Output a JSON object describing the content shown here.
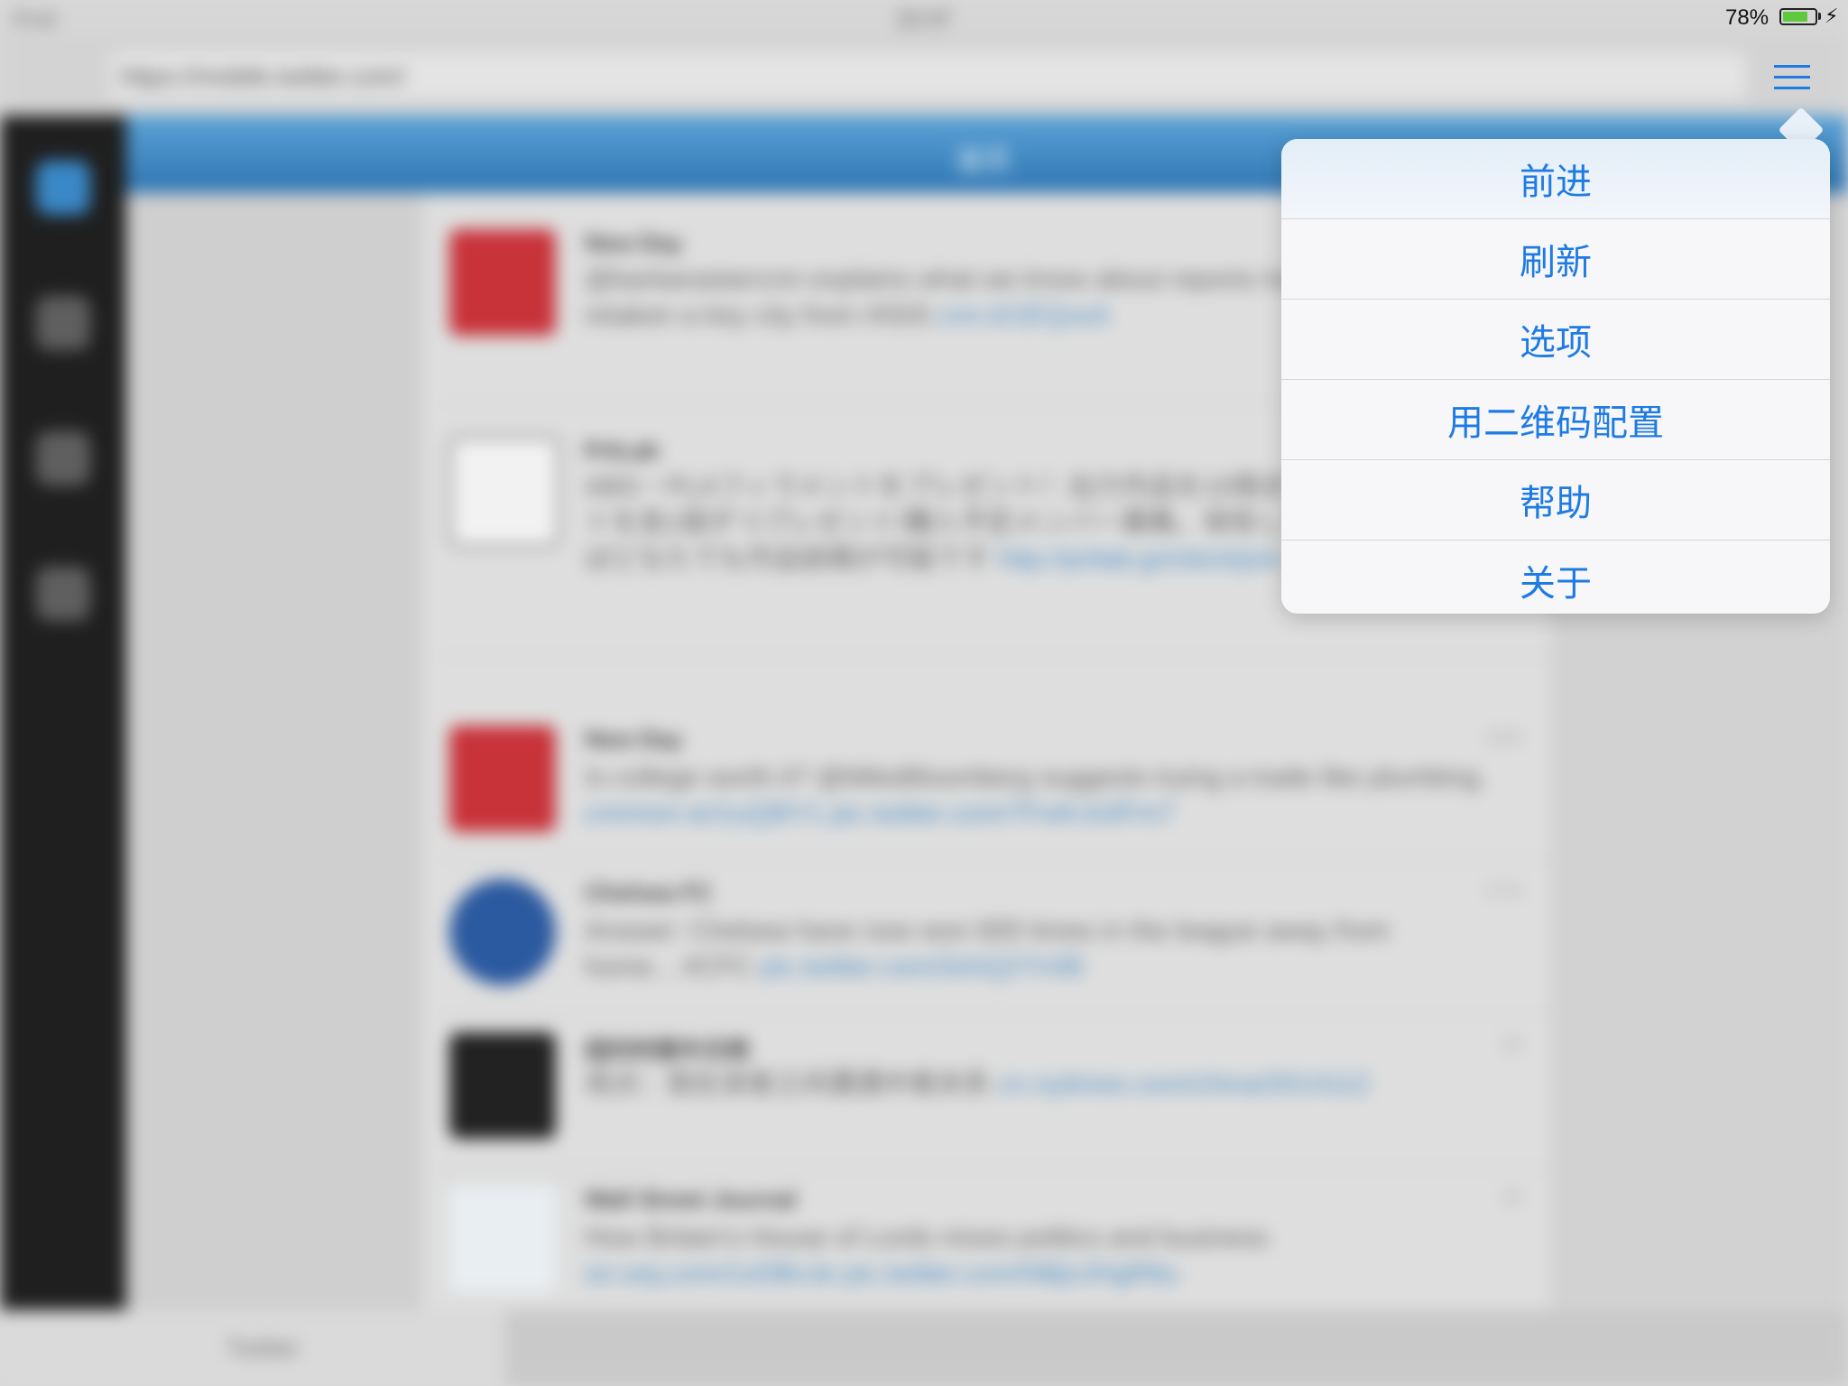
{
  "status_bar": {
    "carrier": "iPad",
    "time": "22:37",
    "battery_percent_text": "78%",
    "battery_level": 0.78,
    "charging_icon": "bolt-icon"
  },
  "browser": {
    "url": "https://mobile.twitter.com/",
    "menu_icon": "hamburger-menu-icon"
  },
  "app": {
    "header_title": "首页",
    "tweets": [
      {
        "name": "New Day",
        "text": "@barbarastarrcnn explains what we know about reports Iraqi forces have retaken a key city from #ISIS",
        "link": "cnn.it/1EQxsA",
        "time": ""
      },
      {
        "name": "PrtLab",
        "text": "ABS・PLAフィラメントをプレゼント！出力作品を10個まで、フィラメントを各1個ずつプレゼント!購入予定メンバー募集。保有している方で作ればどなたでも作品投稿が可能です",
        "link": "http://prtlab.jp/client/join.",
        "time": ""
      },
      {
        "name": "New Day",
        "text": "Is college worth it? @MikeBloomberg suggests trying a trade like plumbing.",
        "link": "cnnmon.ie/1uQ9iY1 pic.twitter.com/7FwKJv0Fm7",
        "time": "14m"
      },
      {
        "name": "Chelsea FC",
        "text": "Answer: Chelsea have now won 600 times in the league away from home... #CFC",
        "link": "pic.twitter.com/3xhQ27rr0E",
        "time": "17m"
      },
      {
        "name": "纽约时报中文网",
        "text": "观点：我在读者之间遭遇中美关系",
        "link": "cn.nytimes.com/china/2014112",
        "time": "1h"
      },
      {
        "name": "Wall Street Journal",
        "text": "How Britain's House of Lords mixes politics and business",
        "link": "on.wsj.com/1xDBvJe pic.twitter.com/NBjnJHgR6u",
        "time": "1h"
      }
    ]
  },
  "bottom_tab": {
    "label": "Twitter"
  },
  "popover_menu": {
    "items": [
      "前进",
      "刷新",
      "选项",
      "用二维码配置",
      "帮助",
      "关于"
    ]
  }
}
